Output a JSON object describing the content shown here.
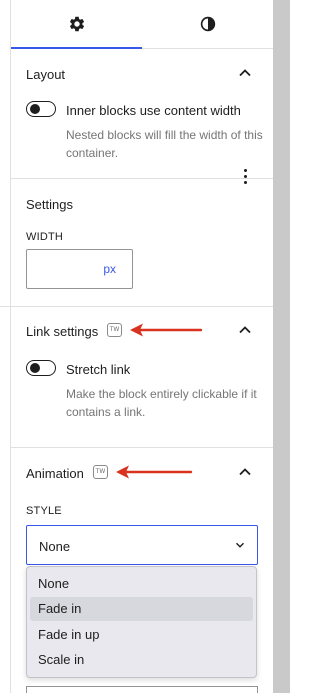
{
  "tabs": [
    {
      "name": "settings",
      "icon": "gear-icon",
      "active": true
    },
    {
      "name": "styles",
      "icon": "half-circle-icon",
      "active": false
    }
  ],
  "layout": {
    "title": "Layout",
    "toggle_label": "Inner blocks use content width",
    "toggle_on": false,
    "help": "Nested blocks will fill the width of this container."
  },
  "settings": {
    "title": "Settings",
    "width_label": "WIDTH",
    "width_value": "",
    "width_unit": "px"
  },
  "link_settings": {
    "title": "Link settings",
    "badge": "TW",
    "toggle_label": "Stretch link",
    "toggle_on": false,
    "help": "Make the block entirely clickable if it contains a link."
  },
  "animation": {
    "title": "Animation",
    "badge": "TW",
    "style_label": "STYLE",
    "selected": "None",
    "options": [
      "None",
      "Fade in",
      "Fade in up",
      "Scale in"
    ],
    "highlighted_option": "Fade in"
  },
  "colors": {
    "accent": "#3858e9",
    "annotation_arrow": "#d9321f",
    "scrollbar": "#c9c9c9"
  }
}
